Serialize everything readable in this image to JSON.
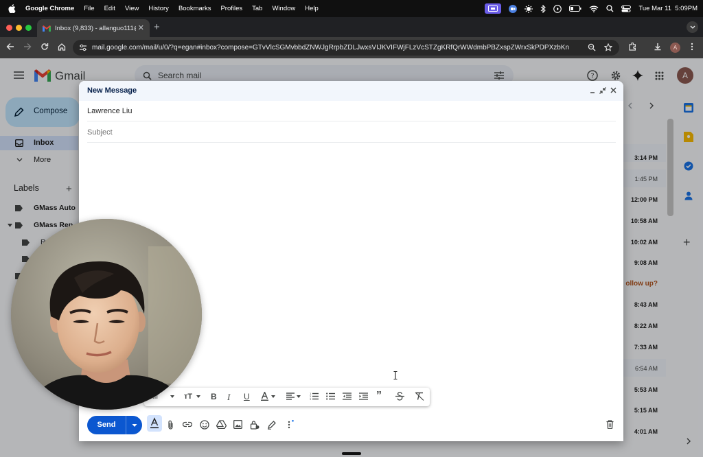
{
  "menubar": {
    "apple_icon": "apple-icon",
    "app_name": "Google Chrome",
    "items": [
      "File",
      "Edit",
      "View",
      "History",
      "Bookmarks",
      "Profiles",
      "Tab",
      "Window",
      "Help"
    ],
    "clock": "Tue Mar 11  5:09PM"
  },
  "browser": {
    "tab_title": "Inbox (9,833) - allanguo111@",
    "url": "mail.google.com/mail/u/0/?q=egan#inbox?compose=GTvVlcSGMvbbdZNWJgRrpbZDLJwxsVIJKVIFWjFLzVcSTZgKRfQrWWdmbPBZxspZWrxSkPDPXzbKn",
    "profile_initial": "A"
  },
  "gmail": {
    "logo_text": "Gmail",
    "search_placeholder": "Search mail",
    "compose_label": "Compose",
    "nav": [
      {
        "label": "Inbox"
      },
      {
        "label": "More"
      }
    ],
    "labels_heading": "Labels",
    "labels": [
      {
        "label": "GMass Auto"
      },
      {
        "label": "GMass Rep"
      },
      {
        "label": "R"
      }
    ],
    "avatar_initial": "A",
    "times": [
      "3:14 PM",
      "1:45 PM",
      "12:00 PM",
      "10:58 AM",
      "10:02 AM",
      "9:08 AM",
      "ollow up?",
      "8:43 AM",
      "8:22 AM",
      "7:33 AM",
      "6:54 AM",
      "5:53 AM",
      "5:15 AM",
      "4:01 AM"
    ]
  },
  "compose": {
    "title": "New Message",
    "recipient": "Lawrence Liu",
    "subject_placeholder": "Subject",
    "subject_value": "",
    "font_label": "iff",
    "send_label": "Send"
  },
  "colors": {
    "send_blue": "#0b57d0",
    "header_bg": "#f2f6fc",
    "gmail_red": "#ea4335"
  }
}
